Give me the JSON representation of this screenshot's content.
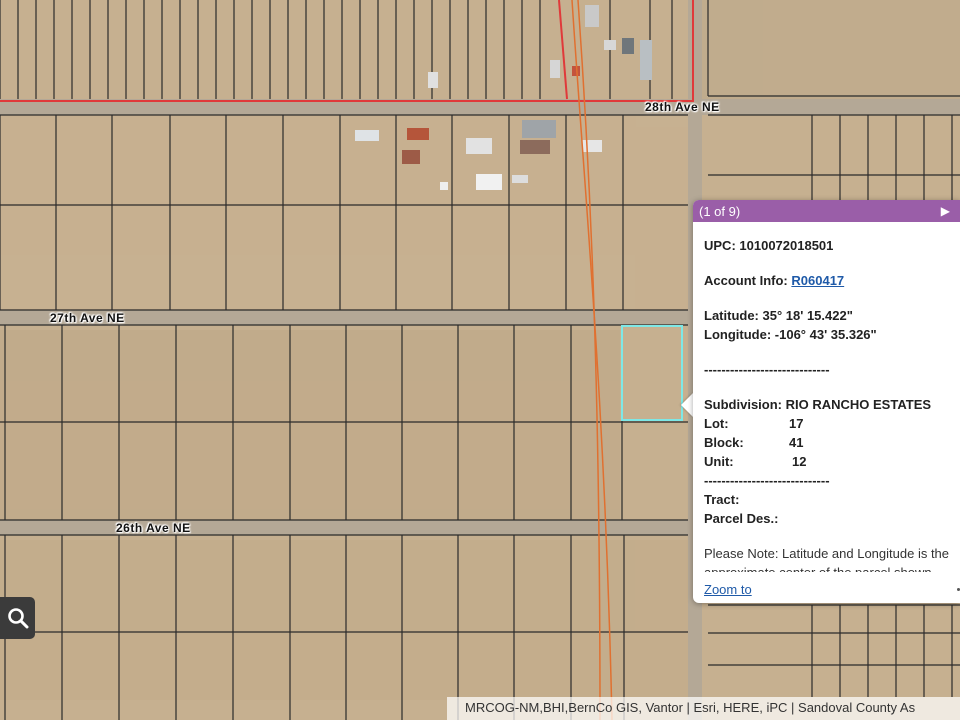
{
  "map": {
    "road_labels": {
      "ave_28": "28th Ave NE",
      "ave_27": "27th Ave NE",
      "ave_26": "26th Ave NE"
    },
    "colors": {
      "boundary_red": "#e0393a",
      "selection_cyan": "#7ee8e6",
      "parcel_lines": "#2b2b2b"
    }
  },
  "search_button": {
    "icon": "search-icon"
  },
  "popup": {
    "pager": "(1 of 9)",
    "next_icon": "play-arrow-icon",
    "upc_label": "UPC:",
    "upc_value": "1010072018501",
    "account_label": "Account Info:",
    "account_value": "R060417",
    "latitude_label": "Latitude:",
    "latitude_value": "35° 18' 15.422\"",
    "longitude_label": "Longitude:",
    "longitude_value": "-106° 43' 35.326\"",
    "separator": "-----------------------------",
    "subdivision_label": "Subdivision:",
    "subdivision_value": "RIO RANCHO ESTATES",
    "lot_label": "Lot:",
    "lot_value": "17",
    "block_label": "Block:",
    "block_value": "41",
    "unit_label": "Unit:",
    "unit_value": "12",
    "tract_label": "Tract:",
    "parcel_des_label": "Parcel Des.:",
    "note_line1": "Please Note: Latitude and Longitude is the",
    "note_line2": "approximate center of the parcel shown",
    "zoom_link": "Zoom to"
  },
  "attribution": "MRCOG-NM,BHI,BernCo GIS, Vantor | Esri, HERE, iPC | Sandoval County As"
}
